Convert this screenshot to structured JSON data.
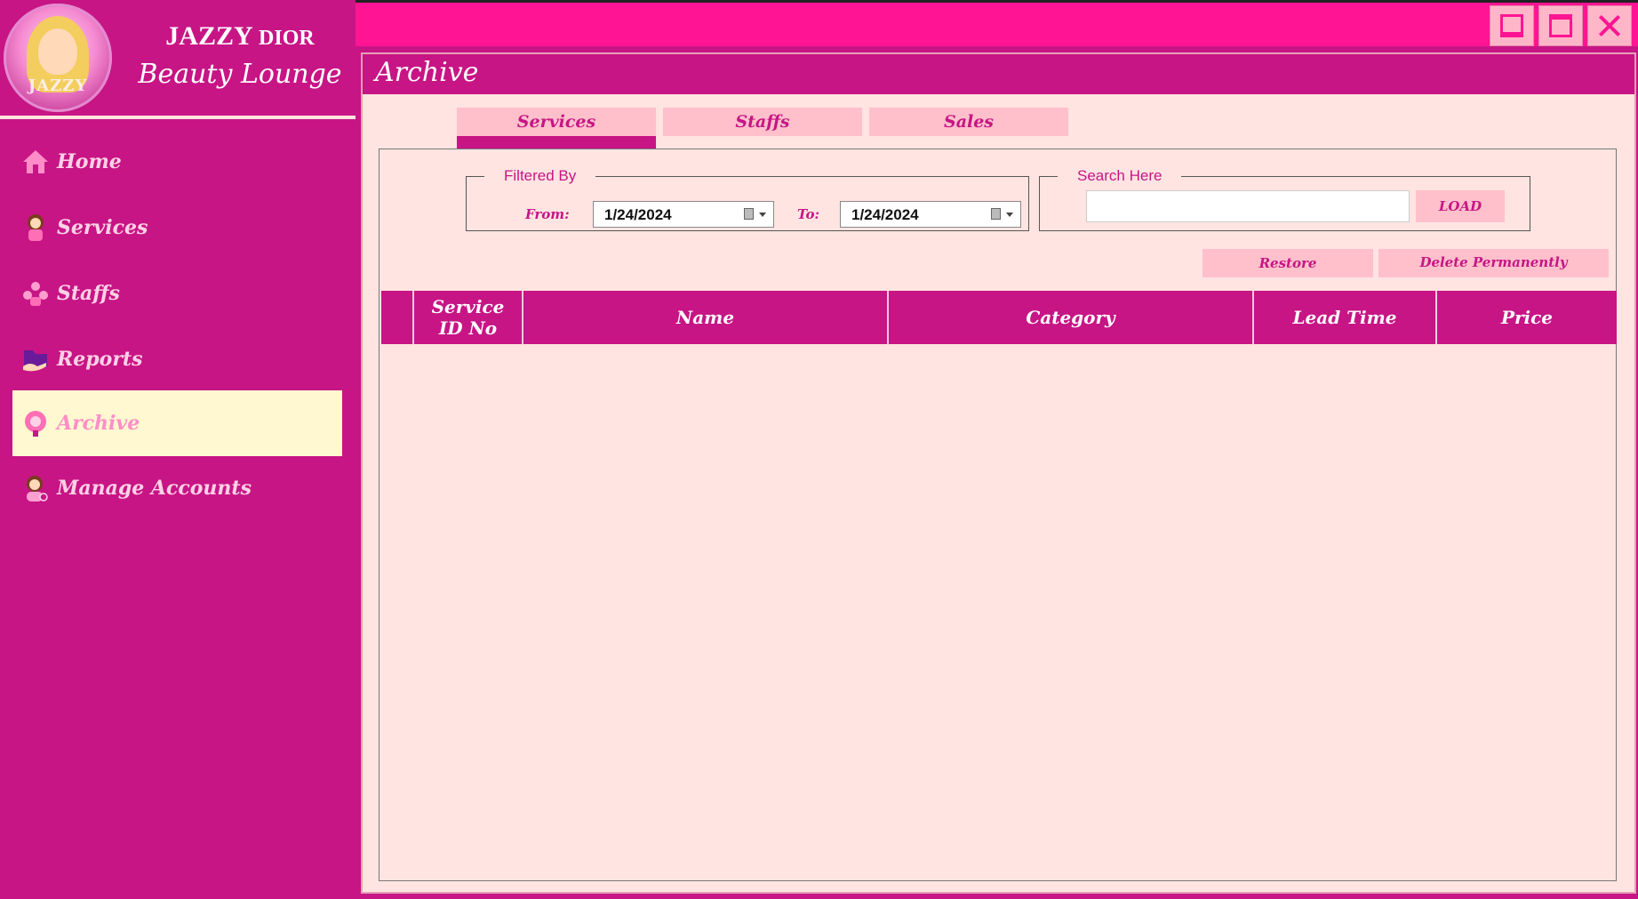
{
  "brand": {
    "logo_text": "JAZZY",
    "title_main": "JAZZY",
    "title_small": "DIOR",
    "subtitle": "Beauty Lounge"
  },
  "sidebar": {
    "items": [
      {
        "label": "Home",
        "icon": "home-icon"
      },
      {
        "label": "Services",
        "icon": "stylist-icon"
      },
      {
        "label": "Staffs",
        "icon": "staff-icon"
      },
      {
        "label": "Reports",
        "icon": "folder-icon"
      },
      {
        "label": "Archive",
        "icon": "archive-icon",
        "active": true
      },
      {
        "label": "Manage Accounts",
        "icon": "user-icon"
      }
    ]
  },
  "window_controls": [
    "minimize-icon",
    "maximize-icon",
    "close-icon"
  ],
  "page": {
    "title": "Archive"
  },
  "tabs": [
    {
      "label": "Services",
      "active": true
    },
    {
      "label": "Staffs",
      "active": false
    },
    {
      "label": "Sales",
      "active": false
    }
  ],
  "filter": {
    "legend": "Filtered By",
    "from_label": "From:",
    "from_value": "1/24/2024",
    "to_label": "To:",
    "to_value": "1/24/2024"
  },
  "search": {
    "legend": "Search Here",
    "value": "",
    "placeholder": "",
    "load_label": "LOAD"
  },
  "actions": {
    "restore_label": "Restore",
    "delete_label": "Delete Permanently"
  },
  "table": {
    "columns": [
      "",
      "Service ID No",
      "Name",
      "Category",
      "Lead Time",
      "Price"
    ],
    "rows": []
  },
  "colors": {
    "sidebar": "#c71585",
    "topbar": "#ff1493",
    "panel": "#ffe4e1",
    "tab": "#ffc0cb",
    "active_nav": "#fff8d0"
  }
}
